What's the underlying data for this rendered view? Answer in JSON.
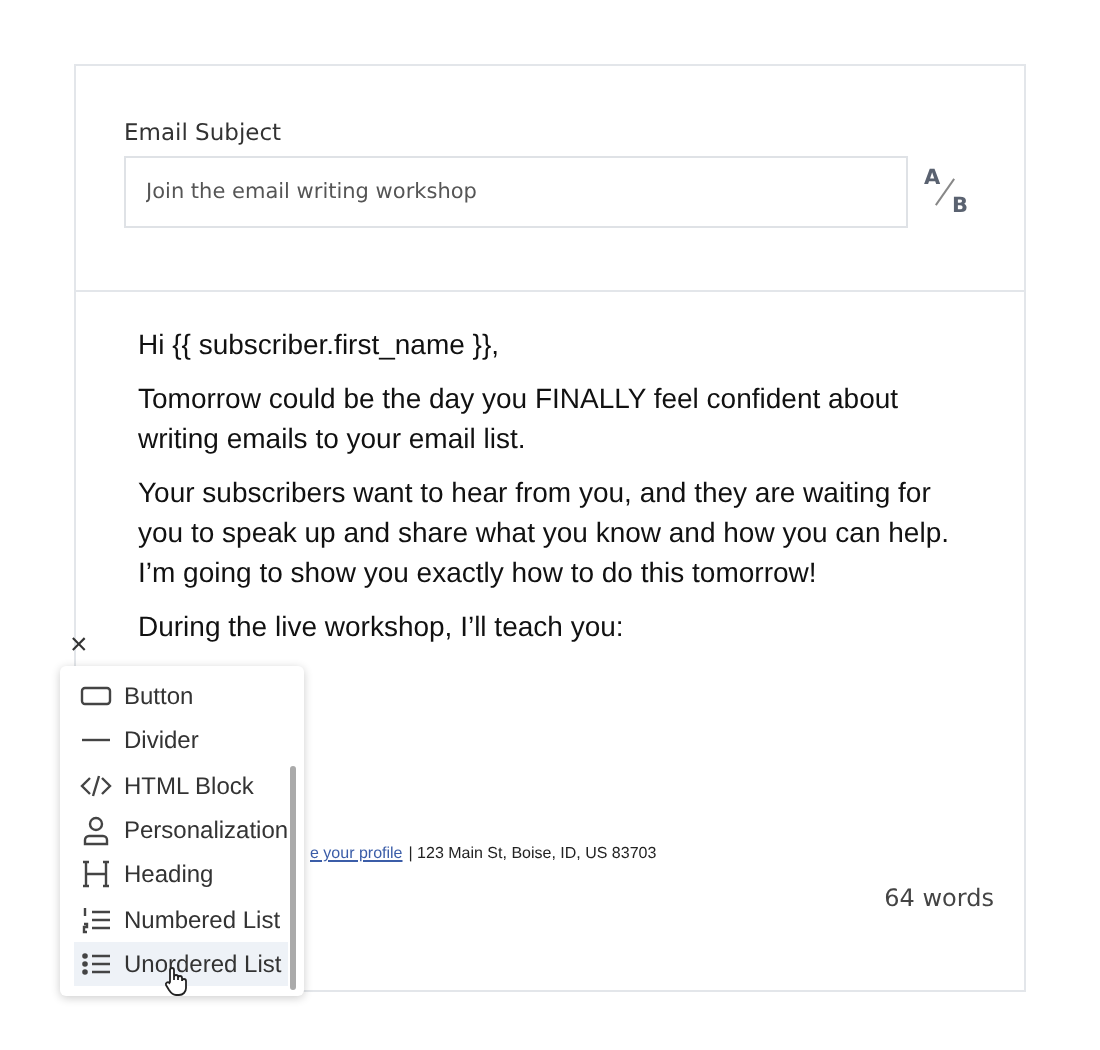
{
  "subject": {
    "label": "Email Subject",
    "value": "Join the email writing workshop",
    "ab_a": "A",
    "ab_b": "B"
  },
  "body": {
    "paragraphs": [
      "Hi {{ subscriber.first_name }},",
      "Tomorrow could be the day you FINALLY feel confident about writing emails to your email list.",
      "Your subscribers want to hear from you, and they are waiting for you to speak up and share what you know and how you can help. I’m going to show you exactly how to do this tomorrow!",
      "During the live workshop, I’ll teach you:"
    ],
    "footer_link": "e your profile",
    "footer_text": "| 123 Main St, Boise, ID, US 83703"
  },
  "word_count": "64 words",
  "close": "×",
  "menu": [
    {
      "kind": "button",
      "label": "Button",
      "selected": false
    },
    {
      "kind": "divider",
      "label": "Divider",
      "selected": false
    },
    {
      "kind": "html",
      "label": "HTML Block",
      "selected": false
    },
    {
      "kind": "person",
      "label": "Personalization",
      "selected": false
    },
    {
      "kind": "heading",
      "label": "Heading",
      "selected": false
    },
    {
      "kind": "numbered",
      "label": "Numbered List",
      "selected": false
    },
    {
      "kind": "unordered",
      "label": "Unordered List",
      "selected": true
    }
  ]
}
